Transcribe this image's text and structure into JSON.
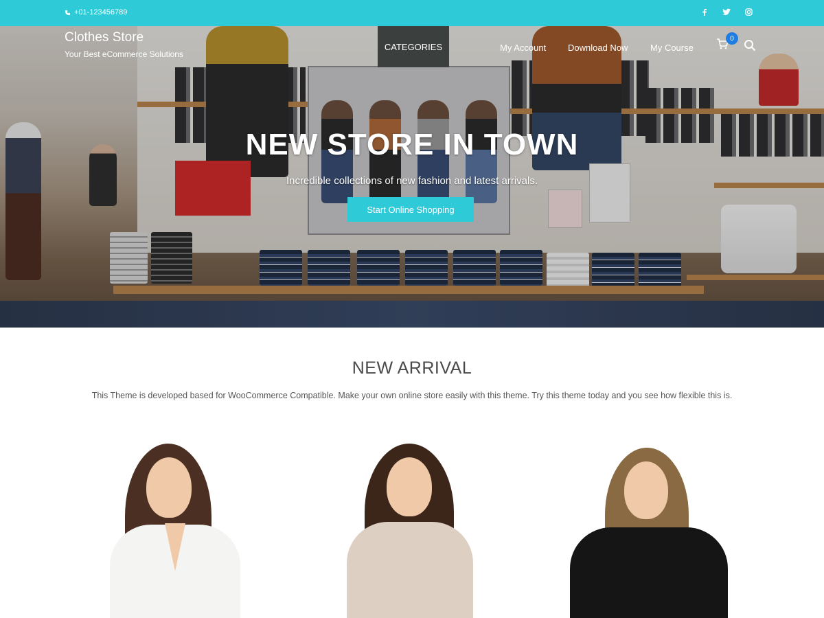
{
  "topbar": {
    "phone": "+01-123456789",
    "social_icons": [
      "facebook-icon",
      "twitter-icon",
      "instagram-icon"
    ],
    "bg_color": "#2fcad8"
  },
  "header": {
    "brand_title": "Clothes Store",
    "brand_subtitle": "Your Best eCommerce Solutions",
    "nav": {
      "categories": "CATEGORIES",
      "my_account": "My Account",
      "download_now": "Download Now",
      "my_course": "My Course"
    },
    "cart_count": "0"
  },
  "hero": {
    "title": "NEW STORE IN TOWN",
    "subtitle": "Incredible collections of new fashion and latest arrivals.",
    "button_label": "Start Online Shopping",
    "accent_color": "#2fcad8"
  },
  "new_arrival": {
    "title": "NEW ARRIVAL",
    "description": "This Theme is developed based for WooCommerce Compatible. Make your own online store easily with this theme. Try this theme today and you see how flexible this is."
  },
  "products": [
    {
      "name": "white-blouse-model"
    },
    {
      "name": "beige-sweater-model"
    },
    {
      "name": "black-lace-top-model"
    }
  ]
}
